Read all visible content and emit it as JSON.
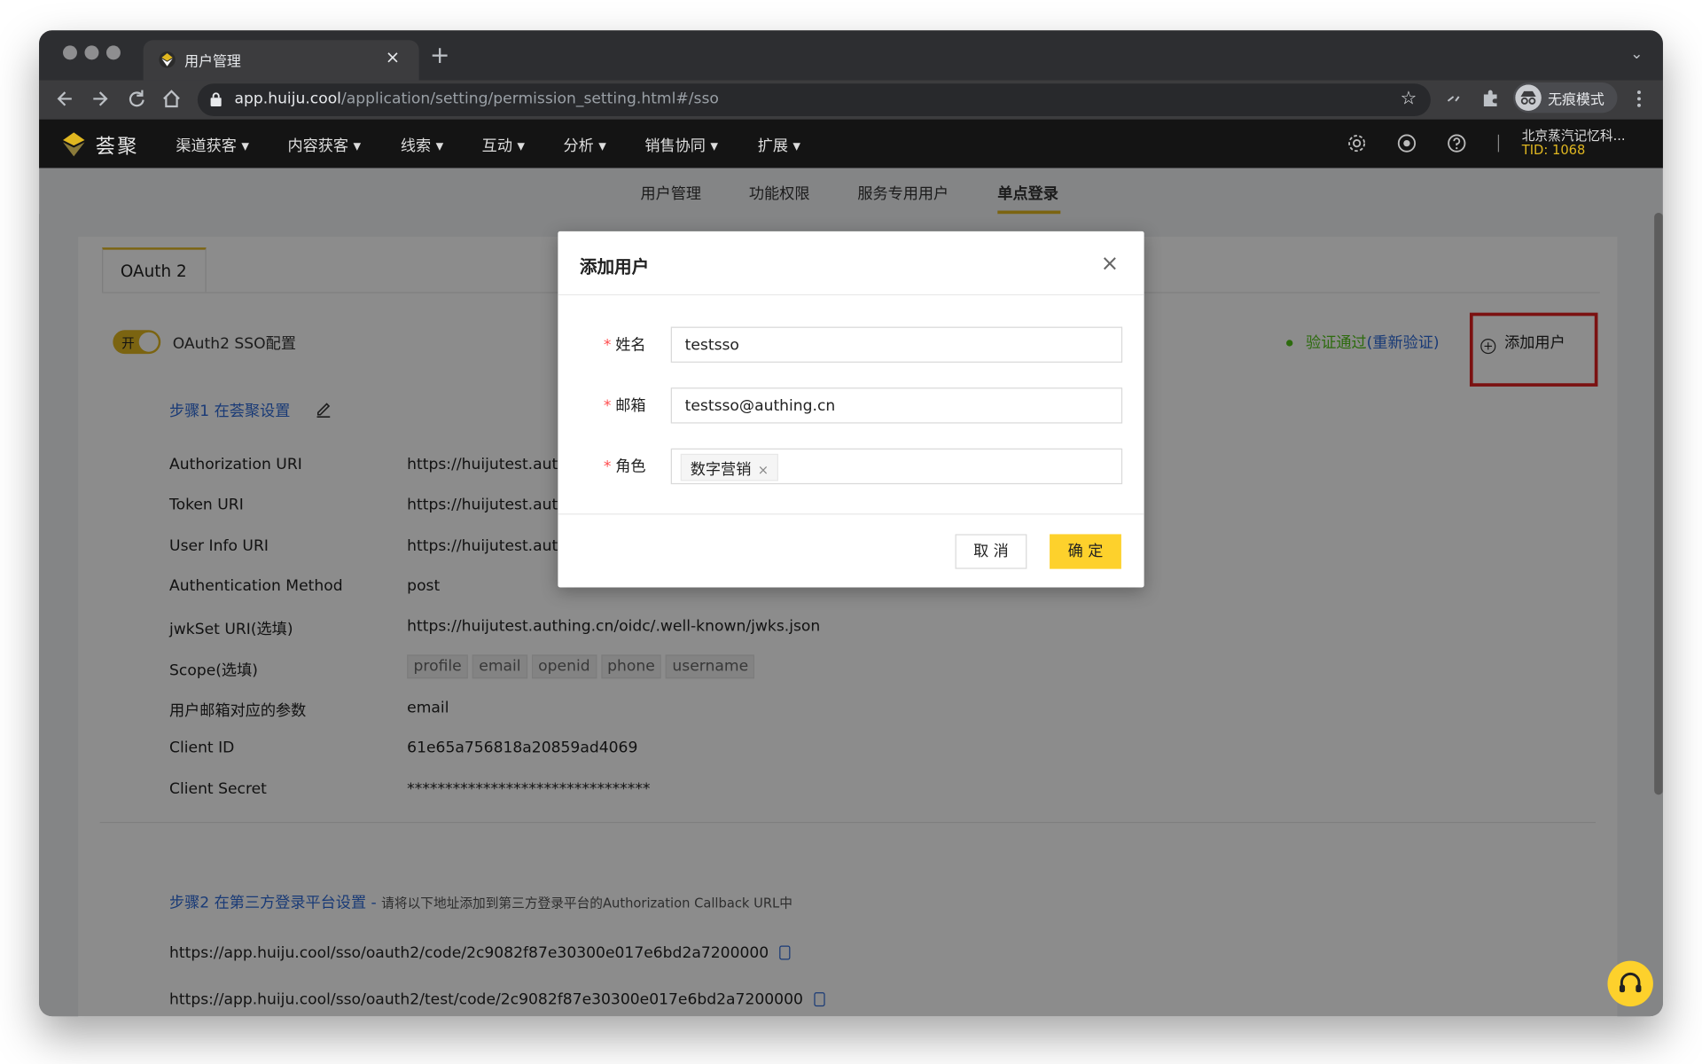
{
  "browser": {
    "tab_title": "用户管理",
    "tab_close": "×",
    "new_tab": "+",
    "tab_menu": "⌄",
    "url_host": "app.huiju.cool",
    "url_path": "/application/setting/permission_setting.html#/sso",
    "incognito_label": "无痕模式",
    "icons": [
      "back-arrow-icon",
      "forward-arrow-icon",
      "reload-icon",
      "home-icon",
      "lock-icon",
      "star-icon",
      "media-icon",
      "extension-icon",
      "incognito-icon",
      "kebab-menu-icon"
    ]
  },
  "app": {
    "logo_text": "荟聚",
    "menu": [
      "渠道获客 ▾",
      "内容获客 ▾",
      "线索 ▾",
      "互动 ▾",
      "分析 ▾",
      "销售协同 ▾",
      "扩展 ▾"
    ],
    "org_name": "北京蒸汽记忆科...",
    "tid": "TID: 1068",
    "brand_color": "#e0b720"
  },
  "subnav": {
    "tabs": [
      "用户管理",
      "功能权限",
      "服务专用用户",
      "单点登录"
    ],
    "active": "单点登录"
  },
  "content": {
    "inner_tab": "OAuth 2",
    "switch_label": "开",
    "sso_label": "OAuth2 SSO配置",
    "verify_text": "验证通过",
    "reverify_text": "(重新验证)",
    "add_user": "添加用户",
    "step1": "步骤1 在荟聚设置",
    "rows": [
      {
        "label": "Authorization URI",
        "value": "https://huijutest.auth"
      },
      {
        "label": "Token URI",
        "value": "https://huijutest.auth"
      },
      {
        "label": "User Info URI",
        "value": "https://huijutest.auth"
      },
      {
        "label": "Authentication Method",
        "value": "post"
      },
      {
        "label": "jwkSet URI(选填)",
        "value": "https://huijutest.authing.cn/oidc/.well-known/jwks.json"
      },
      {
        "label": "Scope(选填)",
        "value": ""
      },
      {
        "label": "用户邮箱对应的参数",
        "value": "email"
      },
      {
        "label": "Client ID",
        "value": "61e65a756818a20859ad4069"
      },
      {
        "label": "Client Secret",
        "value": "********************************"
      }
    ],
    "scopes": [
      "profile",
      "email",
      "openid",
      "phone",
      "username"
    ],
    "step2": "步骤2 在第三方登录平台设置 - ",
    "step2_note": "请将以下地址添加到第三方登录平台的Authorization Callback URL中",
    "callback_urls": [
      "https://app.huiju.cool/sso/oauth2/code/2c9082f87e30300e017e6bd2a7200000",
      "https://app.huiju.cool/sso/oauth2/test/code/2c9082f87e30300e017e6bd2a7200000"
    ]
  },
  "modal": {
    "title": "添加用户",
    "close": "×",
    "required_mark": "*",
    "fields": [
      {
        "label": "姓名",
        "value": "testsso"
      },
      {
        "label": "邮箱",
        "value": "testsso@authing.cn"
      },
      {
        "label": "角色",
        "tag": "数字营销",
        "tag_remove": "×"
      }
    ],
    "cancel": "取 消",
    "ok": "确 定"
  }
}
